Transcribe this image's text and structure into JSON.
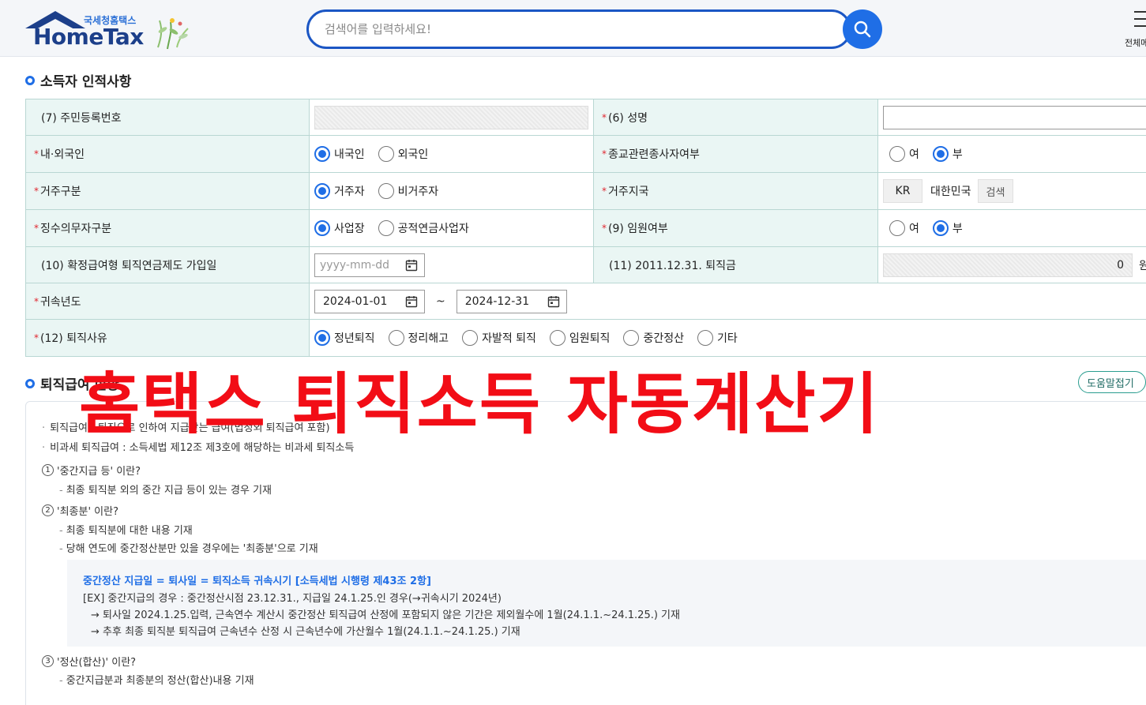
{
  "header": {
    "logo_sub": "국세청홈택스",
    "logo_main": "HomeTax",
    "search_placeholder": "검색어를 입력하세요!",
    "menu_label": "전체메뉴"
  },
  "sections": {
    "personal_title": "소득자 인적사항",
    "benefit_title": "퇴직급여 현황"
  },
  "form": {
    "resident_no_label": "(7) 주민등록번호",
    "name_label": "(6) 성명",
    "nationality_label": "내·외국인",
    "nationality_options": [
      "내국인",
      "외국인"
    ],
    "religion_label": "종교관련종사자여부",
    "religion_options": [
      "여",
      "부"
    ],
    "residence_label": "거주구분",
    "residence_options": [
      "거주자",
      "비거주자"
    ],
    "country_label": "거주지국",
    "country_code": "KR",
    "country_name": "대한민국",
    "country_search": "검색",
    "withholder_label": "징수의무자구분",
    "withholder_options": [
      "사업장",
      "공적연금사업자"
    ],
    "executive_label": "(9) 임원여부",
    "executive_options": [
      "여",
      "부"
    ],
    "dc_join_label": "(10) 확정급여형 퇴직연금제도 가입일",
    "dc_join_placeholder": "yyyy-mm-dd",
    "severance_2011_label": "(11) 2011.12.31. 퇴직금",
    "severance_2011_value": "0",
    "severance_2011_unit": "원",
    "year_label": "귀속년도",
    "year_from": "2024-01-01",
    "year_to": "2024-12-31",
    "year_sep": "~",
    "reason_label": "(12) 퇴직사유",
    "reason_options": [
      "정년퇴직",
      "정리해고",
      "자발적 퇴직",
      "임원퇴직",
      "중간정산",
      "기타"
    ]
  },
  "help": {
    "toggle_label": "도움말접기",
    "note1": "퇴직급여 : 퇴직으로 인하여 지급받는 급여(법정외 퇴직급여 포함)",
    "note2": "비과세 퇴직급여 : 소득세법 제12조 제3호에 해당하는 비과세 퇴직소득",
    "q1": "'중간지급 등' 이란?",
    "q1_a": "최종 퇴직분 외의 중간 지급 등이 있는 경우 기재",
    "q2": "'최종분' 이란?",
    "q2_a1": "최종 퇴직분에 대한 내용 기재",
    "q2_a2": "당해 연도에 중간정산분만 있을 경우에는 '최종분'으로 기재",
    "ex_title": "중간정산 지급일 = 퇴사일 = 퇴직소득 귀속시기 [소득세법 시행령 제43조 2항]",
    "ex_line1": "[EX] 중간지급의 경우 : 중간정산시점 23.12.31., 지급일 24.1.25.인 경우(→귀속시기 2024년)",
    "ex_line2": "→ 퇴사일 2024.1.25.입력, 근속연수 계산시 중간정산 퇴직급여 산정에 포함되지 않은 기간은 제외월수에 1월(24.1.1.~24.1.25.) 기재",
    "ex_line3": "→ 추후 최종 퇴직분 퇴직급여 근속년수 산정 시 근속년수에 가산월수 1월(24.1.1.~24.1.25.) 기재",
    "q3": "'정산(합산)' 이란?",
    "q3_a": "중간지급분과 최종분의 정산(합산)내용 기재"
  },
  "overlay_text": "홈택스 퇴직소득 자동계산기",
  "colors": {
    "accent": "#1f6ee6",
    "label_bg": "#eaf6f4",
    "overlay": "#f20d16",
    "required": "#e0262f"
  }
}
